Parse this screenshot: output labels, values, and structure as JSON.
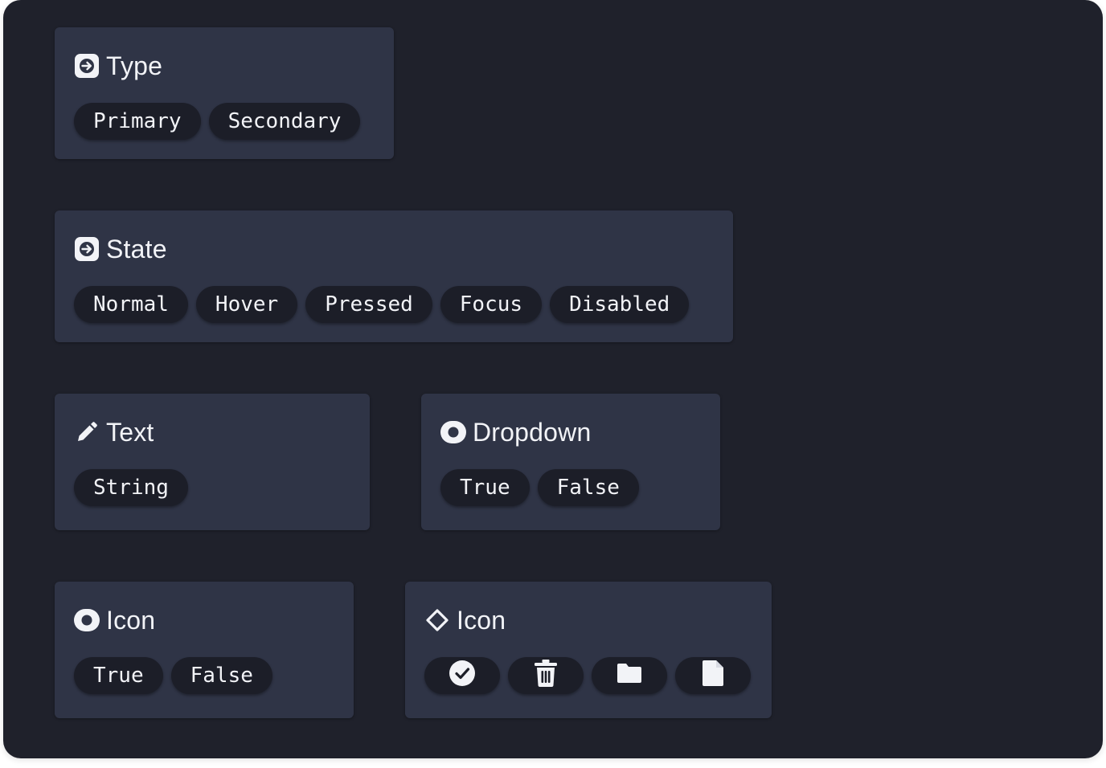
{
  "colors": {
    "background": "#1f212b",
    "card": "#2f3446",
    "chip": "#1c1e28",
    "text": "#f2f3f7"
  },
  "cards": {
    "type": {
      "icon": "arrow-right-square-icon",
      "title": "Type",
      "options": [
        "Primary",
        "Secondary"
      ]
    },
    "state": {
      "icon": "arrow-right-square-icon",
      "title": "State",
      "options": [
        "Normal",
        "Hover",
        "Pressed",
        "Focus",
        "Disabled"
      ]
    },
    "text": {
      "icon": "pencil-icon",
      "title": "Text",
      "options": [
        "String"
      ]
    },
    "dropdown": {
      "icon": "toggle-eye-icon",
      "title": "Dropdown",
      "options": [
        "True",
        "False"
      ]
    },
    "icon_toggle": {
      "icon": "toggle-eye-icon",
      "title": "Icon",
      "options": [
        "True",
        "False"
      ]
    },
    "icon_swap": {
      "icon": "diamond-icon",
      "title": "Icon",
      "options": [
        "check-circle-icon",
        "trash-icon",
        "folder-icon",
        "file-icon"
      ]
    }
  }
}
